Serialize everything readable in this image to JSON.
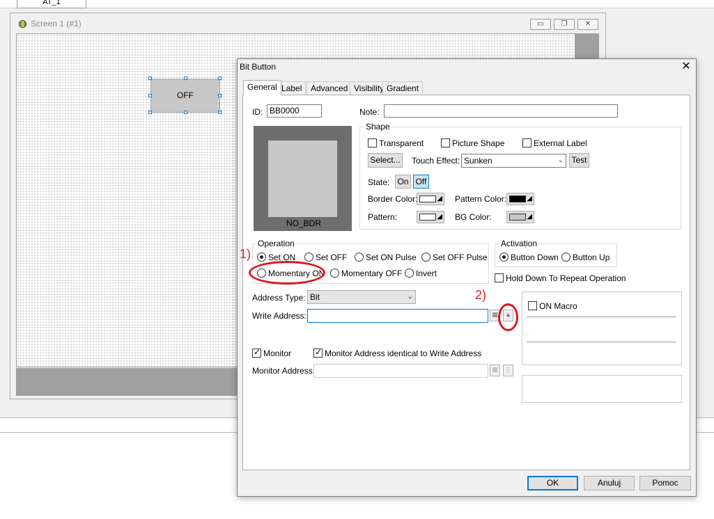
{
  "editor": {
    "top_tab_label": "AT_1",
    "screen_title": "Screen 1 (#1)",
    "off_widget_label": "OFF"
  },
  "dialog": {
    "title": "Bit Button",
    "close_glyph": "✕",
    "tabs": [
      {
        "label": "General",
        "active": true
      },
      {
        "label": "Label"
      },
      {
        "label": "Advanced"
      },
      {
        "label": "Visibility"
      },
      {
        "label": "Gradient"
      }
    ],
    "id_label": "ID:",
    "id_value": "BB0000",
    "note_label": "Note:",
    "note_value": "",
    "preview_label": "NO_BDR",
    "shape": {
      "title": "Shape",
      "transparent": "Transparent",
      "picture_shape": "Picture Shape",
      "external_label": "External Label",
      "select_btn": "Select...",
      "touch_effect_label": "Touch Effect:",
      "touch_effect_value": "Sunken",
      "test_btn": "Test",
      "state_label": "State:",
      "state_on": "On",
      "state_off": "Off",
      "border_color_label": "Border Color:",
      "pattern_color_label": "Pattern Color:",
      "pattern_label": "Pattern:",
      "bg_color_label": "BG Color:",
      "colors": {
        "border": "#ffffff",
        "pattern_color": "#000000",
        "pattern": "#ffffff",
        "bg": "#c8c8c8"
      }
    },
    "operation": {
      "title": "Operation",
      "options": [
        "Set ON",
        "Set OFF",
        "Set ON Pulse",
        "Set OFF Pulse",
        "Momentary ON",
        "Momentary OFF",
        "Invert"
      ],
      "selected": "Set ON"
    },
    "activation": {
      "title": "Activation",
      "options": [
        "Button Down",
        "Button Up"
      ],
      "selected": "Button Down",
      "hold_down": "Hold Down To Repeat Operation"
    },
    "address_type_label": "Address Type:",
    "address_type_value": "Bit",
    "write_address_label": "Write Address:",
    "write_address_value": "",
    "monitor_label": "Monitor",
    "monitor_identical_label": "Monitor Address identical to Write Address",
    "monitor_address_label": "Monitor Address:",
    "on_macro_label": "ON Macro",
    "buttons": {
      "ok": "OK",
      "cancel": "Anuluj",
      "help": "Pomoc"
    }
  },
  "annotations": {
    "one": "1)",
    "two": "2)",
    "color": "#e0141e"
  }
}
